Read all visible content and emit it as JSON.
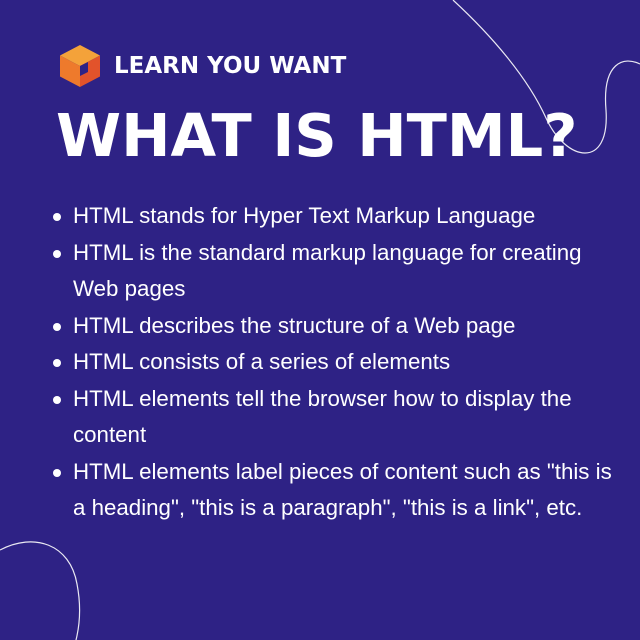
{
  "brand": {
    "name": "LEARN YOU WANT",
    "logo_icon": "isometric-cube-icon",
    "logo_colors": [
      "#f4a23a",
      "#ee7a2c",
      "#e2532b"
    ]
  },
  "title": "WHAT IS HTML?",
  "bullets": [
    "HTML stands for Hyper Text Markup Language",
    "HTML is the standard markup language for creating Web pages",
    "HTML describes the structure of a Web page",
    "HTML consists of a series of elements",
    "HTML elements tell the browser how to display the content",
    "HTML elements label pieces of content such as \"this is a heading\", \"this is a paragraph\", \"this is a link\", etc."
  ],
  "colors": {
    "background": "#2e2285",
    "text": "#ffffff"
  }
}
